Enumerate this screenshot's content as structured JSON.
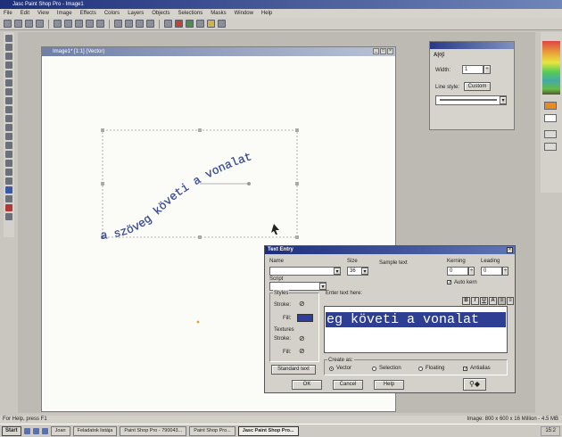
{
  "app": {
    "title": "Jasc Paint Shop Pro - Image1"
  },
  "menu": [
    "File",
    "Edit",
    "View",
    "Image",
    "Effects",
    "Colors",
    "Layers",
    "Objects",
    "Selections",
    "Masks",
    "Window",
    "Help"
  ],
  "image_window": {
    "title": "Image1* [1:1] (Vector)"
  },
  "canvas_text": {
    "value": "a szöveg követi a vonalat"
  },
  "line_panel": {
    "width_label": "Width:",
    "width_value": "1",
    "line_style_label": "Line style:",
    "custom_button": "Custom"
  },
  "text_entry": {
    "title": "Text Entry",
    "name_label": "Name",
    "size_label": "Size",
    "size_value": "36",
    "sample_label": "Sample text",
    "script_label": "Script",
    "kerning_label": "Kerning",
    "leading_label": "Leading",
    "kerning_value": "0",
    "leading_value": "0",
    "auto_kern_label": "Auto kern",
    "styles_label": "Styles",
    "stroke_label": "Stroke:",
    "fill_label": "Fill:",
    "textures_label": "Textures",
    "tex_stroke_label": "Stroke:",
    "tex_fill_label": "Fill:",
    "enter_text_label": "Enter text here:",
    "entered_text": "eg követi a vonalat",
    "standard_text_button": "Standard text",
    "create_as_label": "Create as:",
    "create_options": [
      "Vector",
      "Selection",
      "Floating"
    ],
    "antialias_label": "Antialias",
    "ok_button": "OK",
    "cancel_button": "Cancel",
    "help_button": "Help",
    "fill_color": "#2d3e9c"
  },
  "status": {
    "left": "For Help, press F1",
    "right": "Image: 800 x 600 x 16 Million - 4.5 MB"
  },
  "taskbar": {
    "start_label": "Start",
    "tasks": [
      "Joan",
      "Feladatok listája",
      "Paint Shop Pro - 790043...",
      "Paint Shop Pro...",
      "Jasc Paint Shop Pro..."
    ],
    "active_index": 4,
    "clock": "15:2"
  },
  "colors": {
    "title_blue": "#1e2f7a",
    "selection_blue": "#2e3f93",
    "canvas_text": "#3b4f94"
  }
}
